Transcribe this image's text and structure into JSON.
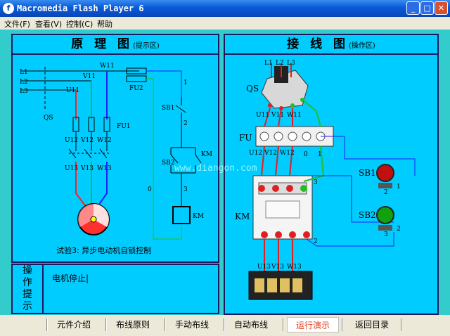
{
  "window": {
    "title": "Macromedia Flash Player 6",
    "app_icon": "f",
    "minimize": "_",
    "maximize": "□",
    "close": "✕"
  },
  "menu": [
    "文件(F)",
    "查看(V)",
    "控制(C)",
    "帮助"
  ],
  "left_panel": {
    "title": "原 理 图",
    "subtitle": "(提示区)",
    "caption": "试验3: 异步电动机自锁控制",
    "labels": {
      "L1": "L1",
      "L2": "L2",
      "L3": "L3",
      "W11": "W11",
      "V11": "V11",
      "U11": "U11",
      "FU2": "FU2",
      "QS": "QS",
      "U12": "U12",
      "V12": "V12",
      "W12": "W12",
      "FU1": "FU1",
      "U13": "U13",
      "V13": "V13",
      "W13": "W13",
      "SB1": "SB1",
      "SB2": "SB2",
      "KM": "KM",
      "KM2": "KM",
      "KM3": "KM",
      "n1": "1",
      "n2": "2",
      "n3": "3",
      "n0": "0"
    }
  },
  "right_panel": {
    "title": "接 线 图",
    "subtitle": "(操作区)",
    "labels": {
      "L1": "L1",
      "L2": "L2",
      "L3": "L3",
      "QS": "QS",
      "FU": "FU",
      "KM": "KM",
      "SB1": "SB1",
      "SB2": "SB2",
      "U11": "U11",
      "V11": "V11",
      "W11": "W11",
      "U12": "U12",
      "V12": "V12",
      "W12": "W12",
      "U13": "U13",
      "V13": "V13",
      "W13": "W13",
      "t0": "0",
      "t1": "1",
      "t2": "2",
      "t3": "3",
      "sb1a": "1",
      "sb1b": "2",
      "sb2a": "2",
      "sb2b": "3"
    }
  },
  "watermark": "www.diangon.com",
  "hint": {
    "head": [
      "操",
      "作",
      "提",
      "示"
    ],
    "text": "电机停止|"
  },
  "nav": [
    "元件介绍",
    "布线原则",
    "手动布线",
    "自动布线",
    "运行演示",
    "返回目录"
  ]
}
